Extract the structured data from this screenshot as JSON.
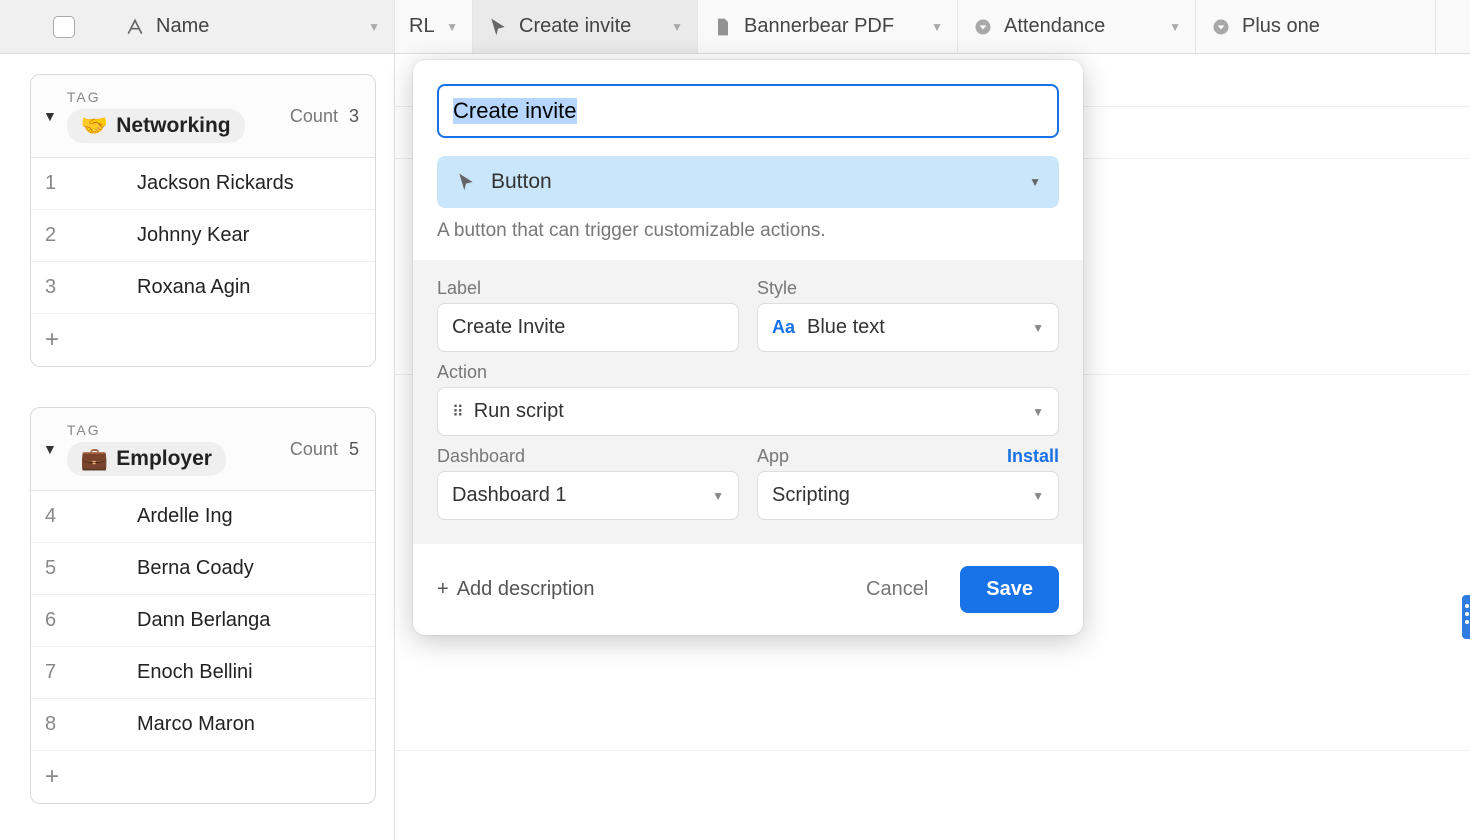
{
  "columns": {
    "name": "Name",
    "rl": "RL",
    "create_invite": "Create invite",
    "bannerbear": "Bannerbear PDF",
    "attendance": "Attendance",
    "plus_one": "Plus one"
  },
  "groups": [
    {
      "tag_label": "TAG",
      "emoji": "🤝",
      "title": "Networking",
      "count_label": "Count",
      "count": "3",
      "rows": [
        {
          "num": "1",
          "name": "Jackson Rickards"
        },
        {
          "num": "2",
          "name": "Johnny Kear"
        },
        {
          "num": "3",
          "name": "Roxana Agin"
        }
      ]
    },
    {
      "tag_label": "TAG",
      "emoji": "💼",
      "title": "Employer",
      "count_label": "Count",
      "count": "5",
      "rows": [
        {
          "num": "4",
          "name": "Ardelle Ing"
        },
        {
          "num": "5",
          "name": "Berna Coady"
        },
        {
          "num": "6",
          "name": "Dann Berlanga"
        },
        {
          "num": "7",
          "name": "Enoch Bellini"
        },
        {
          "num": "8",
          "name": "Marco Maron"
        }
      ]
    }
  ],
  "popup": {
    "field_name": "Create invite",
    "type": {
      "label": "Button"
    },
    "type_desc": "A button that can trigger customizable actions.",
    "label_section": "Label",
    "label_value": "Create Invite",
    "style_section": "Style",
    "style_value": "Blue text",
    "action_section": "Action",
    "action_value": "Run script",
    "dashboard_section": "Dashboard",
    "dashboard_value": "Dashboard 1",
    "app_section": "App",
    "app_value": "Scripting",
    "install": "Install",
    "add_description": "Add description",
    "cancel": "Cancel",
    "save": "Save"
  }
}
